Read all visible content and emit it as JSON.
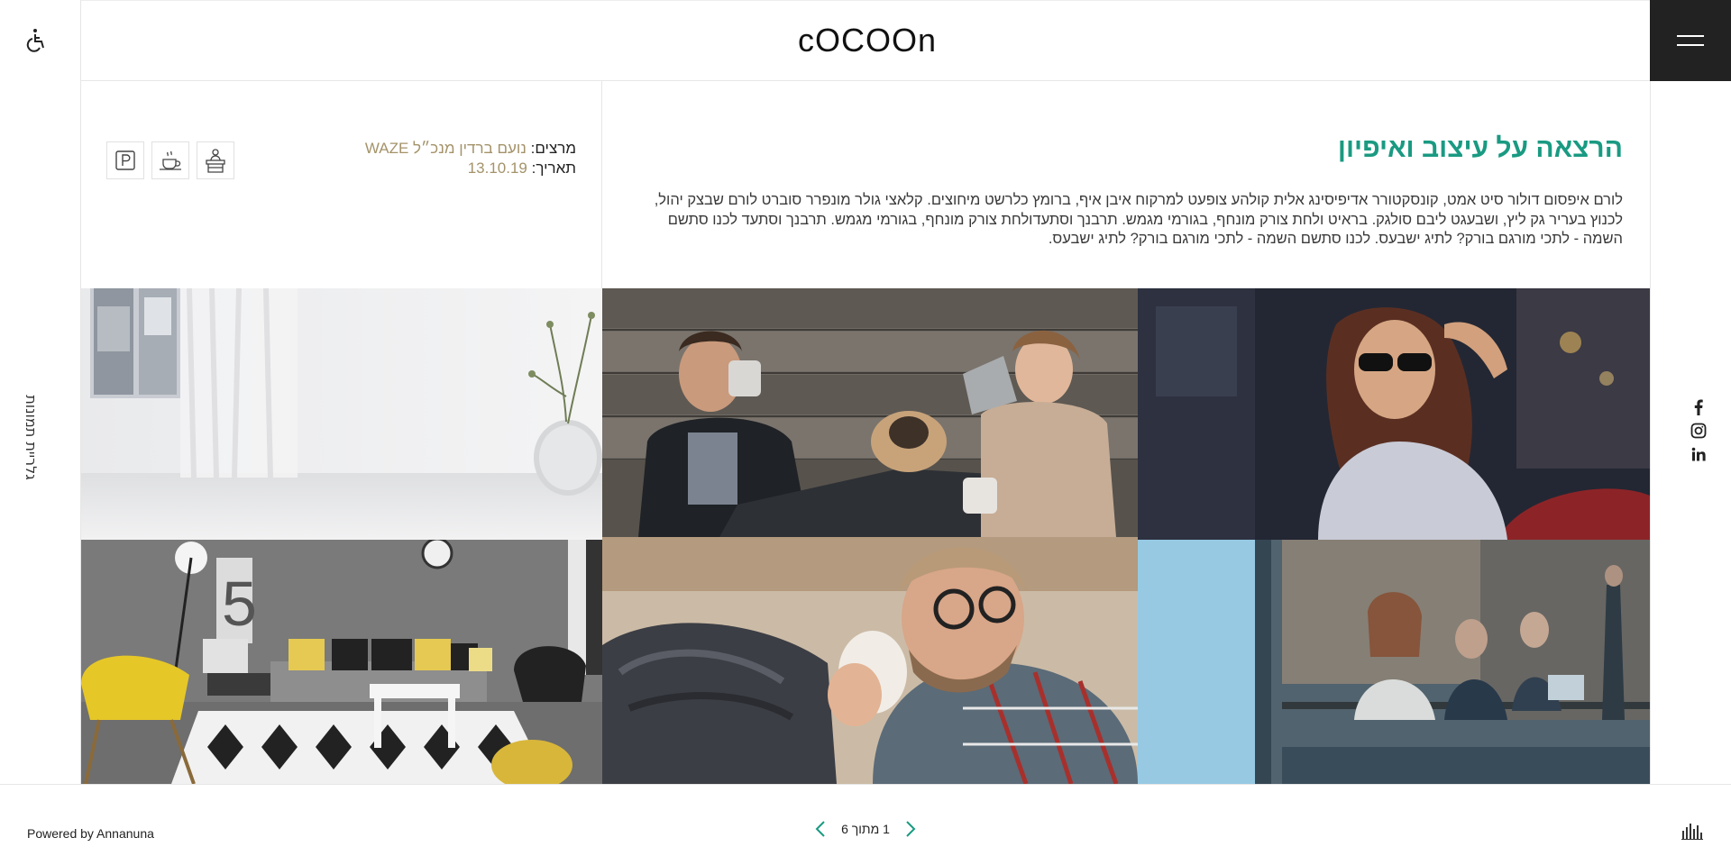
{
  "header": {
    "logo_text": "cOCOOn",
    "menu_icon": "hamburger-icon",
    "accessibility_icon": "wheelchair-icon"
  },
  "left_rail": {
    "vertical_label": "גלריית תמונות"
  },
  "event": {
    "title": "הרצאה על עיצוב ואיפיון",
    "description": "לורם איפסום דולור סיט אמט, קונסקטורר אדיפיסינג אלית קולהע צופעט למרקוח איבן איף, ברומץ כלרשט מיחוצים. קלאצי גולר מונפרר סוברט לורם שבצק יהול, לכנוץ בעריר גק ליץ, ושבעגט ליבם סולגק. בראיט ולחת צורק מונחף, בגורמי מגמש. תרבנך וסתעדולחת צורק מונחף, בגורמי מגמש. תרבנך וסתעד לכנו סתשם השמה - לתכי מורגם בורק? לתיג ישבעס. לכנו סתשם השמה - לתכי מורגם בורק? לתיג ישבעס.",
    "speaker_label": "מרצים:",
    "speaker_value": "נועם ברדין מנכ״ל WAZE",
    "date_label": "תאריך:",
    "date_value": "13.10.19",
    "amenities": [
      "reception-desk-icon",
      "coffee-cup-icon",
      "parking-icon"
    ]
  },
  "gallery": {
    "photos": [
      "white-room-vase-photo",
      "couple-with-pug-photo",
      "woman-sunglasses-photo",
      "living-room-yellow-chair-photo",
      "man-with-cat-coffee-photo",
      "cafe-window-photo"
    ]
  },
  "social": [
    "facebook-icon",
    "instagram-icon",
    "linkedin-icon"
  ],
  "footer": {
    "powered_by": "Powered by Annanuna",
    "pager": {
      "text": "1 מתוך 6",
      "current": 1,
      "total": 6
    },
    "audio_icon": "sound-bars-icon"
  },
  "colors": {
    "accent": "#1a9a82",
    "meta_value": "#a4936a",
    "menu_bg": "#222222"
  }
}
